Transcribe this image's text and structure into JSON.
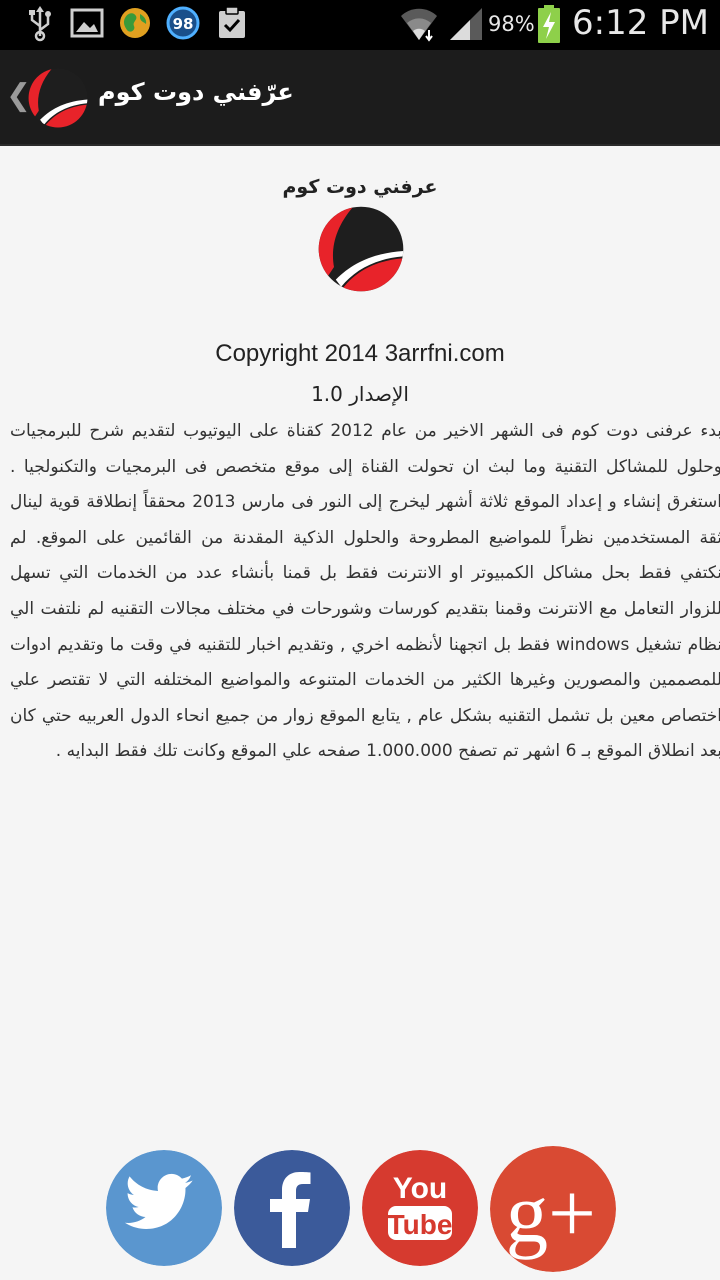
{
  "status_bar": {
    "notification_badge": "98",
    "battery": "98%",
    "time": "6:12 PM"
  },
  "action_bar": {
    "back_glyph": "❮",
    "title": "عرّفني دوت كوم"
  },
  "about": {
    "title": "عرفني دوت كوم",
    "copyright": "Copyright 2014 3arrfni.com",
    "version": "الإصدار 1.0",
    "description": "بدء عرفنى دوت كوم فى الشهر الاخير من عام 2012 كقناة على اليوتيوب لتقديم شرح للبرمجيات وحلول للمشاكل التقنية وما لبث ان تحولت القناة إلى موقع متخصص فى البرمجيات والتكنولجيا .      استغرق إنشاء و إعداد الموقع ثلاثة أشهر ليخرج إلى النور فى مارس 2013 محققاً إنطلاقة قوية لينال ثقة المستخدمين نظراً للمواضيع المطروحة والحلول الذكية المقدنة من القائمين على الموقع.      لم نكتفي فقط بحل مشاكل الكمبيوتر او الانترنت فقط بل قمنا بأنشاء عدد من الخدمات التي تسهل للزوار التعامل مع الانترنت وقمنا بتقديم كورسات وشورحات في مختلف مجالات التقنيه لم نلتفت الي نظام تشغيل windows فقط بل اتجهنا لأنظمه اخري , وتقديم اخبار للتقنيه في وقت ما وتقديم ادوات للمصممين والمصورين وغيرها الكثير من الخدمات المتنوعه والمواضيع المختلفه التي لا تقتصر علي اختصاص معين بل تشمل التقنيه بشكل عام , يتابع الموقع زوار من جميع انحاء الدول العربيه حتي كان بعد انطلاق الموقع بـ 6 اشهر تم تصفح 1.000.000 صفحه علي الموقع وكانت تلك فقط البدايه ."
  },
  "social": {
    "youtube_you": "You",
    "youtube_tube": "Tube",
    "gplus_text": "g+"
  },
  "colors": {
    "twitter": "#5a96cf",
    "facebook": "#3b5a9a",
    "youtube": "#d63a2f",
    "googleplus": "#d94a33",
    "logo_red": "#e8232a",
    "logo_black": "#1e1e1e"
  }
}
